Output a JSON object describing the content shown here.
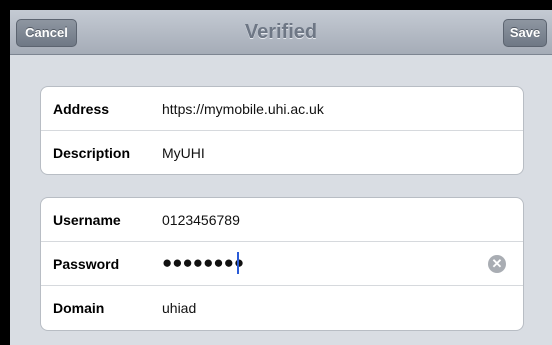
{
  "navbar": {
    "title": "Verified",
    "cancel_label": "Cancel",
    "save_label": "Save"
  },
  "server_group": {
    "rows": [
      {
        "label": "Address",
        "value": "https://mymobile.uhi.ac.uk"
      },
      {
        "label": "Description",
        "value": "MyUHI"
      }
    ]
  },
  "account_group": {
    "username_label": "Username",
    "username_value": "0123456789",
    "password_label": "Password",
    "password_value": "●●●●●●●●",
    "domain_label": "Domain",
    "domain_value": "uhiad"
  },
  "icons": {
    "clear": "clear-field-icon",
    "cursor": "text-cursor"
  },
  "colors": {
    "cursor": "#2a5bd7",
    "navbar_title": "#6e7785"
  }
}
